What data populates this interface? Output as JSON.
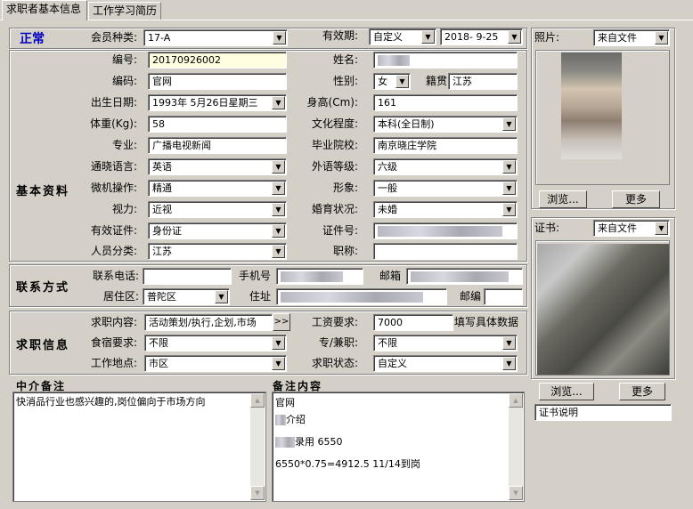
{
  "tabs": [
    "求职者基本信息",
    "工作学习简历"
  ],
  "status": "正常",
  "sections": {
    "basic": "基本资料",
    "contact": "联系方式",
    "job": "求职信息",
    "agent_note": "中介备注",
    "note_content": "备注内容"
  },
  "member_type": {
    "label": "会员种类:",
    "value": "17-A"
  },
  "validity": {
    "label": "有效期:",
    "value": "自定义",
    "date": "2018- 9-25"
  },
  "photo": {
    "label": "照片:",
    "source": "来自文件",
    "browse": "浏览...",
    "more": "更多"
  },
  "cert": {
    "label": "证书:",
    "source": "来自文件",
    "browse": "浏览...",
    "more": "更多",
    "desc": "证书说明"
  },
  "fields": {
    "number": {
      "label": "编号:",
      "value": "20170926002"
    },
    "name": {
      "label": "姓名:",
      "value": ""
    },
    "code": {
      "label": "编码:",
      "value": "官网"
    },
    "gender": {
      "label": "性别:",
      "value": "女"
    },
    "native": {
      "label": "籍贯",
      "value": "江苏"
    },
    "birth": {
      "label": "出生日期:",
      "value": "1993年 5月26日星期三"
    },
    "height": {
      "label": "身高(Cm):",
      "value": "161"
    },
    "weight": {
      "label": "体重(Kg):",
      "value": "58"
    },
    "education": {
      "label": "文化程度:",
      "value": "本科(全日制)"
    },
    "major": {
      "label": "专业:",
      "value": "广播电视新闻"
    },
    "school": {
      "label": "毕业院校:",
      "value": "南京晓庄学院"
    },
    "language": {
      "label": "通晓语言:",
      "value": "英语"
    },
    "lang_level": {
      "label": "外语等级:",
      "value": "六级"
    },
    "computer": {
      "label": "微机操作:",
      "value": "精通"
    },
    "image": {
      "label": "形象:",
      "value": "一般"
    },
    "vision": {
      "label": "视力:",
      "value": "近视"
    },
    "marital": {
      "label": "婚育状况:",
      "value": "未婚"
    },
    "id_type": {
      "label": "有效证件:",
      "value": "身份证"
    },
    "id_no": {
      "label": "证件号:",
      "value": ""
    },
    "category": {
      "label": "人员分类:",
      "value": "江苏"
    },
    "title": {
      "label": "职称:",
      "value": ""
    },
    "phone": {
      "label": "联系电话:",
      "value": ""
    },
    "mobile": {
      "label": "手机号",
      "value": ""
    },
    "email": {
      "label": "邮箱",
      "value": ""
    },
    "district": {
      "label": "居住区:",
      "value": "普陀区"
    },
    "address": {
      "label": "住址",
      "value": ""
    },
    "zip": {
      "label": "邮编",
      "value": ""
    },
    "job_content": {
      "label": "求职内容:",
      "value": "活动策划/执行,企划,市场"
    },
    "salary": {
      "label": "工资要求:",
      "value": "7000",
      "hint": "填写具体数据"
    },
    "board": {
      "label": "食宿要求:",
      "value": "不限"
    },
    "parttime": {
      "label": "专/兼职:",
      "value": "不限"
    },
    "location": {
      "label": "工作地点:",
      "value": "市区"
    },
    "job_status": {
      "label": "求职状态:",
      "value": "自定义"
    }
  },
  "agent_note_text": "快消品行业也感兴趣的,岗位偏向于市场方向",
  "note_lines": [
    "官网",
    "介绍",
    "录用 6550",
    "6550*0.75=4912.5 11/14到岗"
  ]
}
